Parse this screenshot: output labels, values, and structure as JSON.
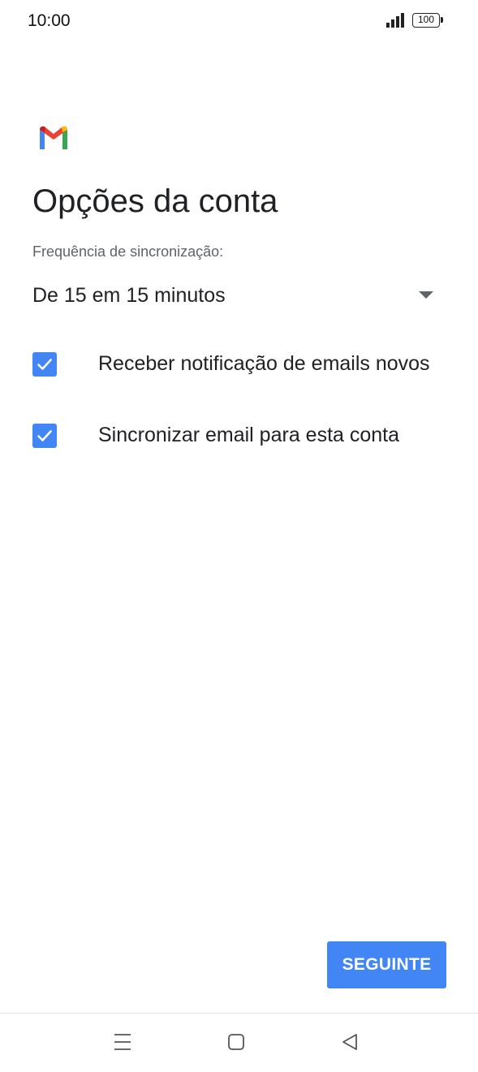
{
  "status_bar": {
    "time": "10:00",
    "battery": "100"
  },
  "header": {
    "title": "Opções da conta"
  },
  "sync": {
    "label": "Frequência de sincronização:",
    "selected": "De 15 em 15 minutos"
  },
  "options": [
    {
      "label": "Receber notificação de emails novos",
      "checked": true
    },
    {
      "label": "Sincronizar email para esta conta",
      "checked": true
    }
  ],
  "actions": {
    "next_label": "SEGUINTE"
  },
  "colors": {
    "accent": "#4285f4",
    "gmail_red": "#ea4335",
    "gmail_blue": "#4285f4",
    "gmail_green": "#34a853",
    "gmail_yellow": "#fbbc04",
    "text_primary": "#202124",
    "text_secondary": "#5f6368"
  },
  "icons": {
    "logo": "gmail-logo-icon",
    "dropdown": "arrow-drop-down-icon",
    "checkbox": "checkbox-checked-icon",
    "nav_menu": "menu-icon",
    "nav_home": "home-square-icon",
    "nav_back": "back-triangle-icon"
  }
}
